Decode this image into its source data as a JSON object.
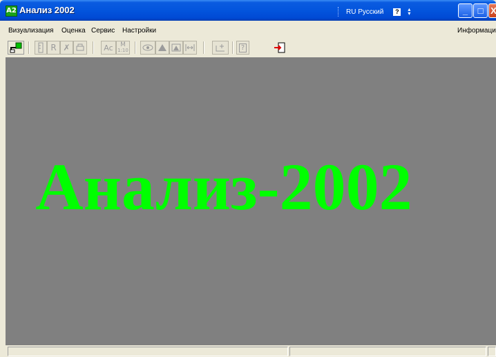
{
  "window": {
    "icon_text": "A2",
    "title": "Анализ 2002"
  },
  "langbar": {
    "language": "RU Русский",
    "help": "?"
  },
  "window_buttons": {
    "minimize": "_",
    "maximize": "□",
    "close": "X"
  },
  "menu": {
    "items": [
      "Визуализация",
      "Оценка",
      "Сервис",
      "Настройки"
    ],
    "right_item": "Информация"
  },
  "toolbar": {
    "r_label": "R",
    "ac_label": "Ac",
    "m_label": "M",
    "m_sub": "1:10",
    "help_label": "?"
  },
  "canvas": {
    "banner_text": "Анализ-2002",
    "banner_color": "#00ff00",
    "background_color": "#808080"
  },
  "statusbar": {
    "panels": [
      "",
      "",
      ""
    ]
  }
}
